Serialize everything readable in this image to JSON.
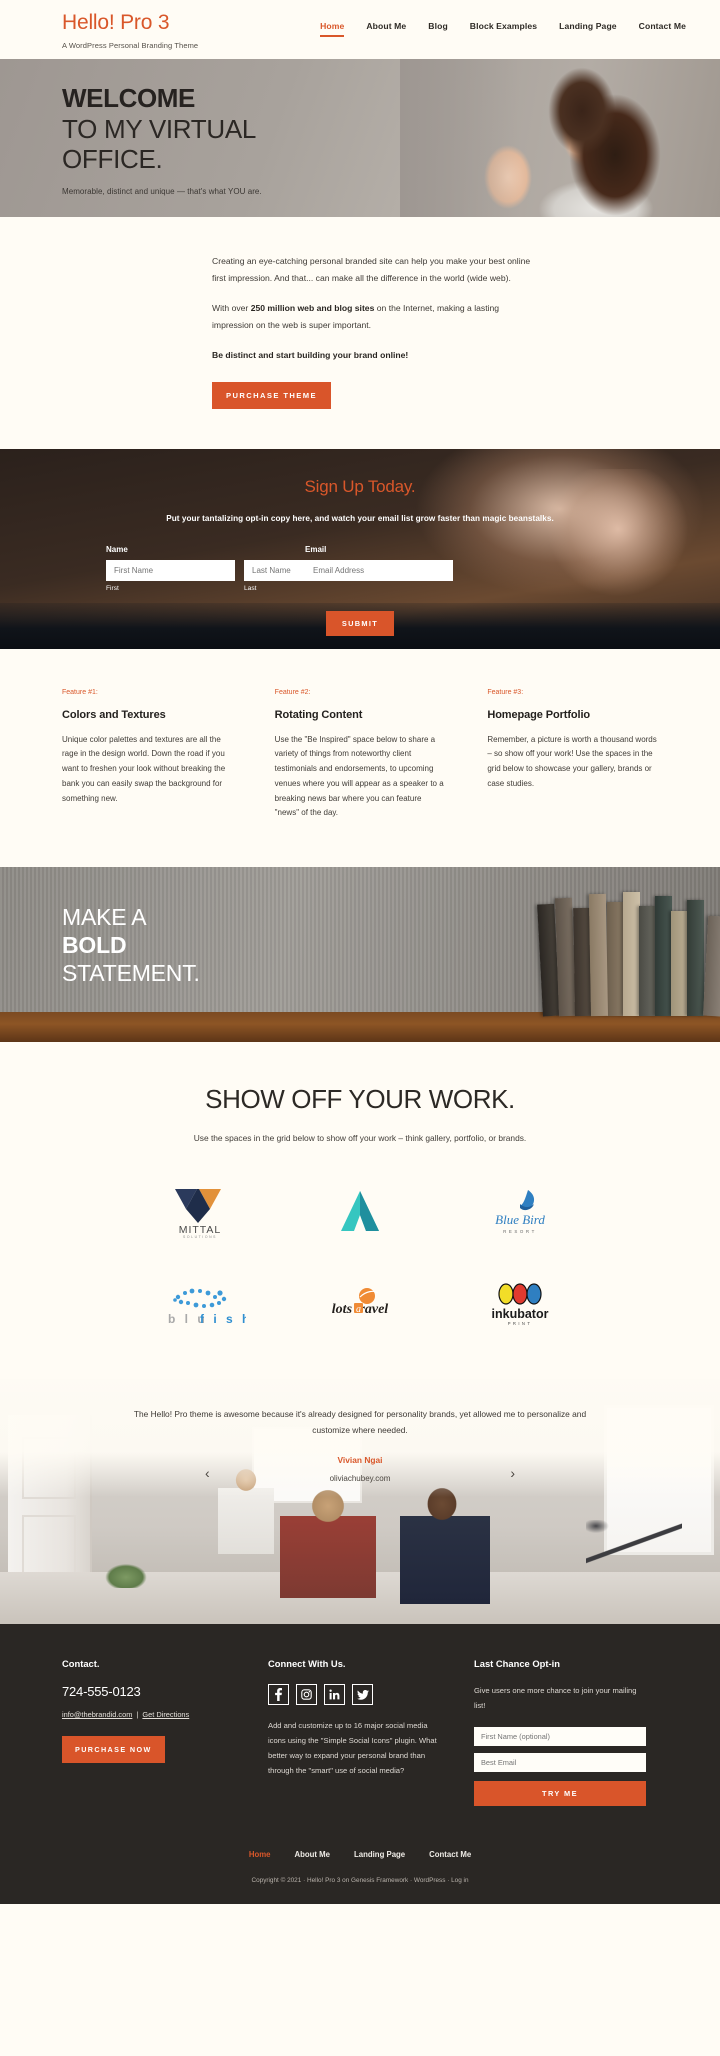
{
  "header": {
    "site_title": "Hello! Pro 3",
    "site_description": "A WordPress Personal Branding Theme",
    "nav": [
      {
        "label": "Home",
        "active": true
      },
      {
        "label": "About Me",
        "active": false
      },
      {
        "label": "Blog",
        "active": false
      },
      {
        "label": "Block Examples",
        "active": false
      },
      {
        "label": "Landing Page",
        "active": false
      },
      {
        "label": "Contact Me",
        "active": false
      }
    ]
  },
  "hero": {
    "line1": "WELCOME",
    "line2": "TO MY VIRTUAL",
    "line3": "OFFICE.",
    "subtitle": "Memorable, distinct and unique — that's what YOU are."
  },
  "intro": {
    "paragraph1": "Creating an eye-catching personal branded site can help you make your best online first impression. And that... can make all the difference in the world (wide web).",
    "paragraph2_pre": "With over ",
    "paragraph2_bold": "250 million web and blog sites",
    "paragraph2_post": " on the Internet, making a lasting impression on the web is super important.",
    "paragraph3": "Be distinct and start building your brand online!",
    "cta_label": "PURCHASE THEME"
  },
  "optin": {
    "title": "Sign Up Today.",
    "subtitle": "Put your tantalizing opt-in copy here, and watch your email list grow faster than magic beanstalks.",
    "name_label": "Name",
    "email_label": "Email",
    "first_placeholder": "First Name",
    "last_placeholder": "Last Name",
    "email_placeholder": "Email Address",
    "first_sublabel": "First",
    "last_sublabel": "Last",
    "submit_label": "SUBMIT"
  },
  "features": [
    {
      "eyebrow": "Feature #1:",
      "title": "Colors and Textures",
      "body": "Unique color palettes and textures are all the rage in the design world. Down the road if you want to freshen your look without breaking the bank you can easily swap the background for something new."
    },
    {
      "eyebrow": "Feature #2:",
      "title": "Rotating Content",
      "body": "Use the \"Be Inspired\" space below to share a variety of things from noteworthy client testimonials and endorsements, to upcoming venues where you will appear as a speaker to a breaking news bar where you can feature \"news\" of the day."
    },
    {
      "eyebrow": "Feature #3:",
      "title": "Homepage Portfolio",
      "body": "Remember, a picture is worth a thousand words – so show off your work! Use the spaces in the grid below to showcase your gallery, brands or case studies."
    }
  ],
  "bold_banner": {
    "line1": "MAKE A",
    "line2": "BOLD",
    "line3": "STATEMENT."
  },
  "showcase": {
    "title": "SHOW OFF YOUR WORK.",
    "subtitle": "Use the spaces in the grid below to show off your work – think gallery, portfolio, or brands.",
    "logos": [
      {
        "name": "MITTAL",
        "sub": "SOLUTIONS",
        "icon": "mittal-logo"
      },
      {
        "name": "A",
        "sub": "",
        "icon": "letter-a-logo"
      },
      {
        "name": "Blue Bird",
        "sub": "RESORT",
        "icon": "bluebird-logo"
      },
      {
        "name": "blufish",
        "sub": "",
        "icon": "blufish-logo"
      },
      {
        "name": "lotsatravel",
        "sub": "",
        "icon": "lotsatravel-logo"
      },
      {
        "name": "inkubator",
        "sub": "PRINT",
        "icon": "inkubator-logo"
      }
    ]
  },
  "testimonial": {
    "quote": "The Hello! Pro theme is awesome because it's already designed for personality brands, yet allowed me to personalize and customize where needed.",
    "author": "Vivian Ngai",
    "site": "oliviachubey.com",
    "prev_icon": "chevron-left-icon",
    "next_icon": "chevron-right-icon"
  },
  "footer": {
    "contact": {
      "title": "Contact.",
      "phone": "724-555-0123",
      "email": "info@thebrandid.com",
      "separator": " | ",
      "directions": "Get Directions",
      "cta_label": "PURCHASE NOW"
    },
    "connect": {
      "title": "Connect With Us.",
      "socials": [
        {
          "name": "facebook-icon",
          "glyph": "f"
        },
        {
          "name": "instagram-icon",
          "glyph": "◎"
        },
        {
          "name": "linkedin-icon",
          "glyph": "in"
        },
        {
          "name": "twitter-icon",
          "glyph": "🐦"
        }
      ],
      "body": "Add and customize up to 16 major social media icons using the \"Simple Social Icons\" plugin. What better way to expand your personal brand than through the \"smart\" use of social media?"
    },
    "optin": {
      "title": "Last Chance Opt-in",
      "body": "Give users one more chance to join your mailing list!",
      "first_placeholder": "First Name (optional)",
      "email_placeholder": "Best Email",
      "cta_label": "TRY ME"
    },
    "nav": [
      {
        "label": "Home",
        "active": true
      },
      {
        "label": "About Me",
        "active": false
      },
      {
        "label": "Landing Page",
        "active": false
      },
      {
        "label": "Contact Me",
        "active": false
      }
    ],
    "credits_prefix": "Copyright © 2021 · ",
    "credits_link1": "Hello! Pro 3",
    "credits_mid1": " on ",
    "credits_link2": "Genesis Framework",
    "credits_mid2": " · ",
    "credits_link3": "WordPress",
    "credits_mid3": " · ",
    "credits_link4": "Log in"
  },
  "colors": {
    "accent": "#d9572a",
    "cream": "#fffcf5",
    "dark": "#2a2724"
  }
}
